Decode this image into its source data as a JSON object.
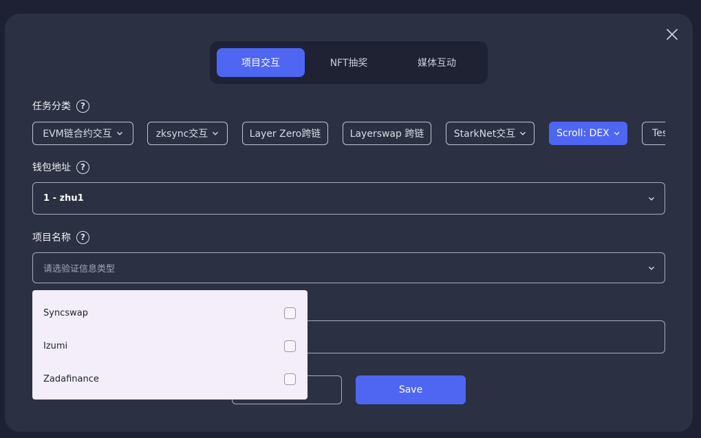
{
  "tabs": [
    {
      "label": "项目交互",
      "active": true
    },
    {
      "label": "NFT抽奖",
      "active": false
    },
    {
      "label": "媒体互动",
      "active": false
    }
  ],
  "task_category": {
    "label": "任务分类",
    "help": "?",
    "chips": [
      {
        "label": "EVM链合约交互",
        "has_dropdown": true,
        "active": false
      },
      {
        "label": "zksync交互",
        "has_dropdown": true,
        "active": false
      },
      {
        "label": "Layer Zero跨链",
        "has_dropdown": false,
        "active": false
      },
      {
        "label": "Layerswap 跨链",
        "has_dropdown": false,
        "active": false
      },
      {
        "label": "StarkNet交互",
        "has_dropdown": true,
        "active": false
      },
      {
        "label": "Scroll: DEX",
        "has_dropdown": true,
        "active": true
      },
      {
        "label": "Tes",
        "has_dropdown": false,
        "active": false
      }
    ]
  },
  "wallet": {
    "label": "钱包地址",
    "help": "?",
    "value": "1 - zhu1"
  },
  "project": {
    "label": "项目名称",
    "help": "?",
    "placeholder": "请选验证信息类型",
    "options": [
      {
        "label": "Syncswap",
        "checked": false
      },
      {
        "label": "Izumi",
        "checked": false
      },
      {
        "label": "Zadafinance",
        "checked": false
      }
    ]
  },
  "actions": {
    "save_label": "Save",
    "cancel_label": ""
  },
  "colors": {
    "accent": "#4e66f2",
    "modal_bg": "#2b3043",
    "page_bg": "#1d2133",
    "dropdown_bg": "#f3eef9"
  }
}
